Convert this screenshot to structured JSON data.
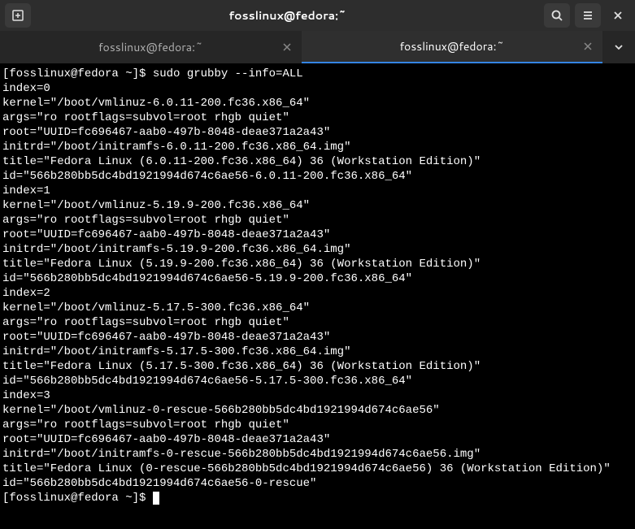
{
  "titlebar": {
    "title": "fosslinux@fedora:~"
  },
  "tabs": [
    {
      "label": "fosslinux@fedora:~",
      "active": false
    },
    {
      "label": "fosslinux@fedora:~",
      "active": true
    }
  ],
  "terminal": {
    "prompt1": "[fosslinux@fedora ~]$ ",
    "command": "sudo grubby --info=ALL",
    "lines": [
      "index=0",
      "kernel=\"/boot/vmlinuz-6.0.11-200.fc36.x86_64\"",
      "args=\"ro rootflags=subvol=root rhgb quiet\"",
      "root=\"UUID=fc696467-aab0-497b-8048-deae371a2a43\"",
      "initrd=\"/boot/initramfs-6.0.11-200.fc36.x86_64.img\"",
      "title=\"Fedora Linux (6.0.11-200.fc36.x86_64) 36 (Workstation Edition)\"",
      "id=\"566b280bb5dc4bd1921994d674c6ae56-6.0.11-200.fc36.x86_64\"",
      "index=1",
      "kernel=\"/boot/vmlinuz-5.19.9-200.fc36.x86_64\"",
      "args=\"ro rootflags=subvol=root rhgb quiet\"",
      "root=\"UUID=fc696467-aab0-497b-8048-deae371a2a43\"",
      "initrd=\"/boot/initramfs-5.19.9-200.fc36.x86_64.img\"",
      "title=\"Fedora Linux (5.19.9-200.fc36.x86_64) 36 (Workstation Edition)\"",
      "id=\"566b280bb5dc4bd1921994d674c6ae56-5.19.9-200.fc36.x86_64\"",
      "index=2",
      "kernel=\"/boot/vmlinuz-5.17.5-300.fc36.x86_64\"",
      "args=\"ro rootflags=subvol=root rhgb quiet\"",
      "root=\"UUID=fc696467-aab0-497b-8048-deae371a2a43\"",
      "initrd=\"/boot/initramfs-5.17.5-300.fc36.x86_64.img\"",
      "title=\"Fedora Linux (5.17.5-300.fc36.x86_64) 36 (Workstation Edition)\"",
      "id=\"566b280bb5dc4bd1921994d674c6ae56-5.17.5-300.fc36.x86_64\"",
      "index=3",
      "kernel=\"/boot/vmlinuz-0-rescue-566b280bb5dc4bd1921994d674c6ae56\"",
      "args=\"ro rootflags=subvol=root rhgb quiet\"",
      "root=\"UUID=fc696467-aab0-497b-8048-deae371a2a43\"",
      "initrd=\"/boot/initramfs-0-rescue-566b280bb5dc4bd1921994d674c6ae56.img\"",
      "title=\"Fedora Linux (0-rescue-566b280bb5dc4bd1921994d674c6ae56) 36 (Workstation Edition)\"",
      "id=\"566b280bb5dc4bd1921994d674c6ae56-0-rescue\""
    ],
    "prompt2": "[fosslinux@fedora ~]$ "
  }
}
